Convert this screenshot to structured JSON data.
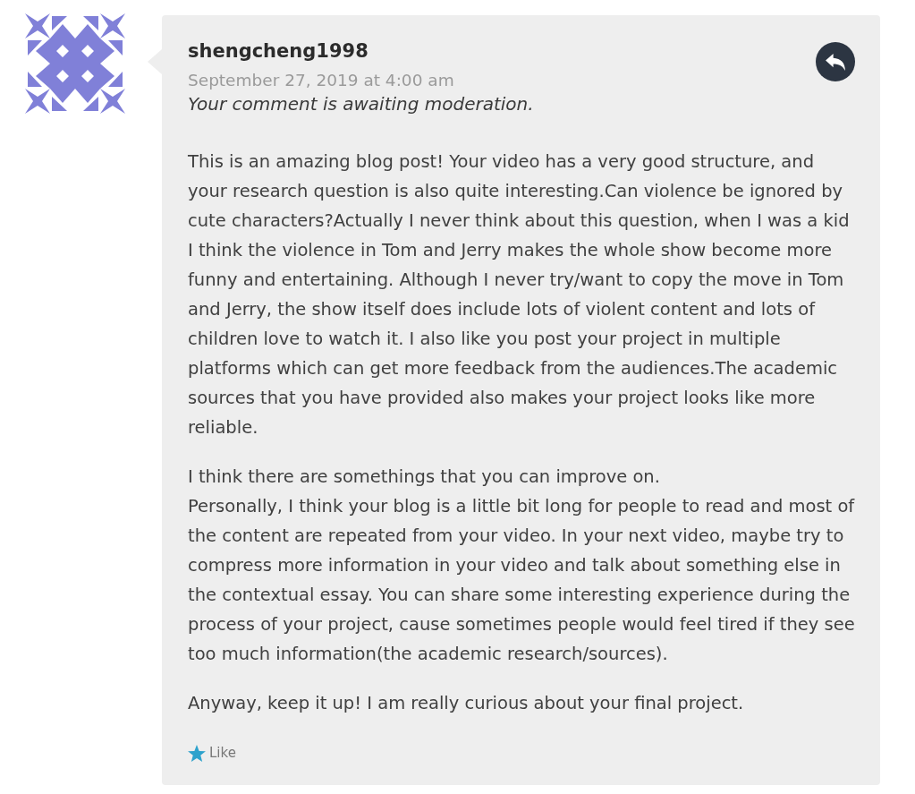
{
  "comment": {
    "author": "shengcheng1998",
    "date": "September 27, 2019 at 4:00 am",
    "notice": "Your comment is awaiting moderation.",
    "paragraphs": [
      "This is an amazing blog post! Your video has a very good structure, and your research question is also quite interesting.Can violence be ignored by cute characters?Actually I never think about this question, when I was a kid I think the violence in Tom and Jerry makes the whole show become more funny and entertaining. Although I never try/want to copy the move in Tom and Jerry, the show itself does include lots of violent content and lots of children love to watch it. I also like you post your project in multiple platforms which can get more feedback from the audiences.The academic sources that you have provided also makes your project looks like more reliable.",
      "I think there are somethings that you can improve on.\nPersonally, I think your blog is a little bit long for people to read and most of the content are repeated from your video. In your next video, maybe try to compress more information in your video and talk about something else in the contextual essay. You can share some interesting experience during the process of your project, cause sometimes people would feel tired if they see too much information(the academic research/sources).",
      "Anyway, keep it up! I am really curious about your final project."
    ],
    "like": "Like"
  }
}
